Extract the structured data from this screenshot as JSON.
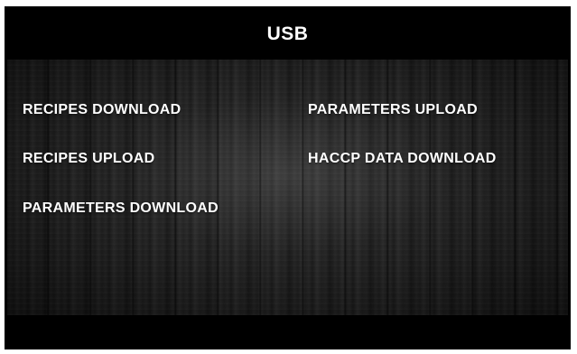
{
  "screen": {
    "title": "USB"
  },
  "menu": {
    "recipes_download": "RECIPES DOWNLOAD",
    "recipes_upload": "RECIPES UPLOAD",
    "parameters_download": "PARAMETERS DOWNLOAD",
    "parameters_upload": "PARAMETERS UPLOAD",
    "haccp_data_download": "HACCP DATA DOWNLOAD"
  },
  "colors": {
    "background": "#000000",
    "text": "#ffffff",
    "panel": "#222222"
  }
}
